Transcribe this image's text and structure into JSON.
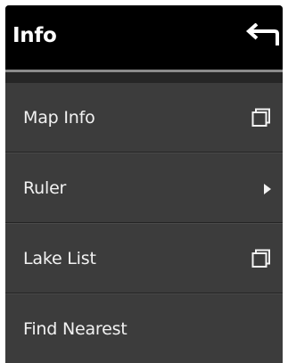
{
  "header": {
    "title": "Info",
    "back_icon": "back-arrow-icon"
  },
  "menu": {
    "items": [
      {
        "label": "Map Info",
        "icon": "window-icon"
      },
      {
        "label": "Ruler",
        "icon": "chevron-right-icon"
      },
      {
        "label": "Lake List",
        "icon": "window-icon"
      },
      {
        "label": "Find Nearest",
        "icon": ""
      }
    ]
  },
  "colors": {
    "header_bg": "#000000",
    "panel_bg": "#3c3c3c",
    "separator": "#8a8a8a",
    "text": "#f2f2f2"
  }
}
